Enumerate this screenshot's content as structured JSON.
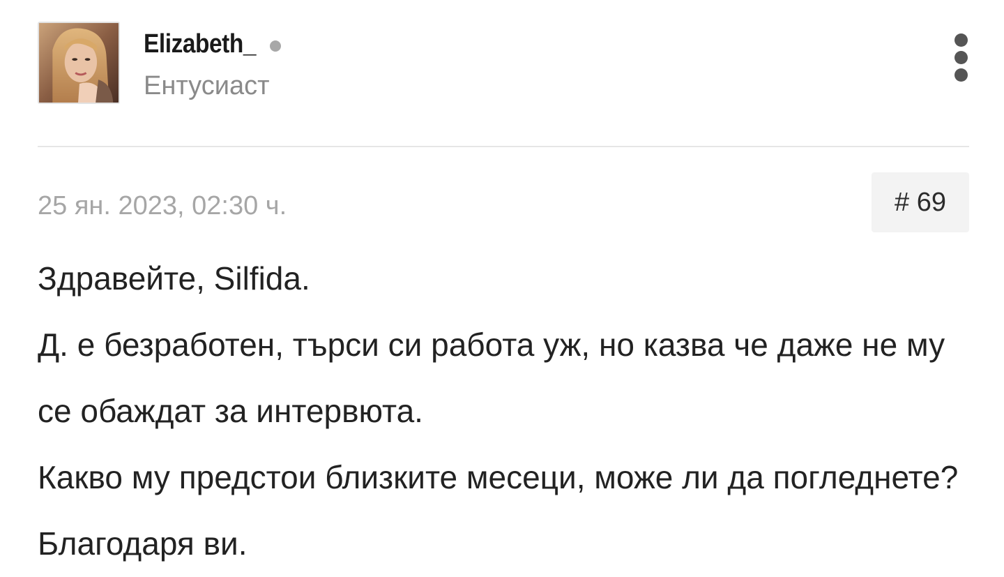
{
  "author": {
    "name": "Elizabeth_",
    "status": "offline",
    "rank": "Ентусиаст"
  },
  "post": {
    "timestamp": "25 ян. 2023, 02:30 ч.",
    "number": "# 69",
    "paragraphs": [
      "Здравейте, Silfida.",
      "Д. е безработен, търси си работа уж, но казва че даже не му се обаждат за интервюта.",
      "Какво му предстои близките месеци, може ли да погледнете? Благодаря ви."
    ]
  },
  "icons": {
    "menu": "more-vertical-icon",
    "status": "status-dot-icon"
  },
  "colors": {
    "status_dot": "#a8a8a8",
    "rank_text": "#8a8a8a",
    "timestamp_text": "#a6a6a6",
    "post_number_bg": "#f3f3f3"
  }
}
